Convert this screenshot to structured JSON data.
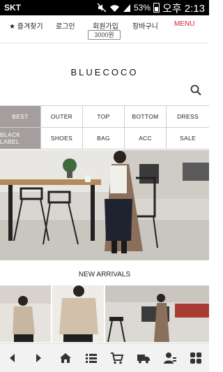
{
  "status_bar": {
    "carrier": "SKT",
    "battery": "53%",
    "time": "오후 2:13"
  },
  "top_menu": {
    "favorites": "★ 즐겨찾기",
    "login": "로그인",
    "join": "회원가입",
    "join_coupon": "3000원",
    "cart": "장바구니",
    "menu": "MENU"
  },
  "brand": {
    "logo": "BLUECOCO"
  },
  "categories": {
    "row1": [
      "BEST",
      "OUTER",
      "TOP",
      "BOTTOM",
      "DRESS"
    ],
    "row2": [
      "BLACK LABEL",
      "SHOES",
      "BAG",
      "ACC",
      "SALE"
    ]
  },
  "sections": {
    "new_arrivals": "NEW ARRIVALS"
  },
  "icons": {
    "status": [
      "mute-icon",
      "wifi-icon",
      "signal-icon",
      "battery-icon"
    ],
    "bottom_nav": [
      "back-icon",
      "forward-icon",
      "home-icon",
      "list-icon",
      "cart-icon",
      "delivery-icon",
      "mypage-icon",
      "grid-icon"
    ]
  },
  "colors": {
    "menu_accent": "#d61f2c",
    "category_highlight": "#a49e9e"
  }
}
